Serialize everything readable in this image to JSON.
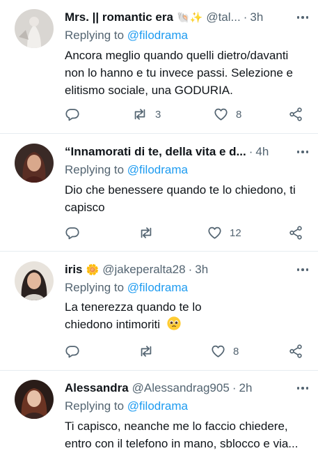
{
  "replies_to": "@filodrama",
  "replying_label": "Replying to",
  "tweets": [
    {
      "name": "Mrs. || romantic era",
      "emojis": "🐚✨",
      "handle": "@tal...",
      "time": "3h",
      "text": "Ancora meglio quando quelli dietro/davanti non lo hanno e tu invece passi. Selezione e elitismo sociale, una GODURIA.",
      "retweets": "3",
      "likes": "8",
      "replies": ""
    },
    {
      "name": "“Innamorati di te, della vita e d...",
      "emojis": "",
      "handle": "",
      "time": "4h",
      "text": "Dio che benessere quando te lo chiedono, ti capisco",
      "retweets": "",
      "likes": "12",
      "replies": ""
    },
    {
      "name": "iris",
      "emojis": "🌼",
      "handle": "@jakeperalta28",
      "time": "3h",
      "text": "La tenerezza quando te lo chiedono intimoriti",
      "text_emoji": "pleading-face-emoji",
      "retweets": "",
      "likes": "8",
      "replies": ""
    },
    {
      "name": "Alessandra",
      "emojis": "",
      "handle": "@Alessandrag905",
      "time": "2h",
      "text": "Ti capisco, neanche me lo faccio chiedere, entro con il telefono in mano, sblocco e via...",
      "retweets": "",
      "likes": "",
      "replies": ""
    }
  ],
  "icons": [
    "reply-icon",
    "retweet-icon",
    "like-icon",
    "share-icon",
    "more-icon"
  ],
  "colors": {
    "text": "#0f1419",
    "secondary": "#536471",
    "accent": "#1d9bf0",
    "divider": "#e6ecf0"
  }
}
